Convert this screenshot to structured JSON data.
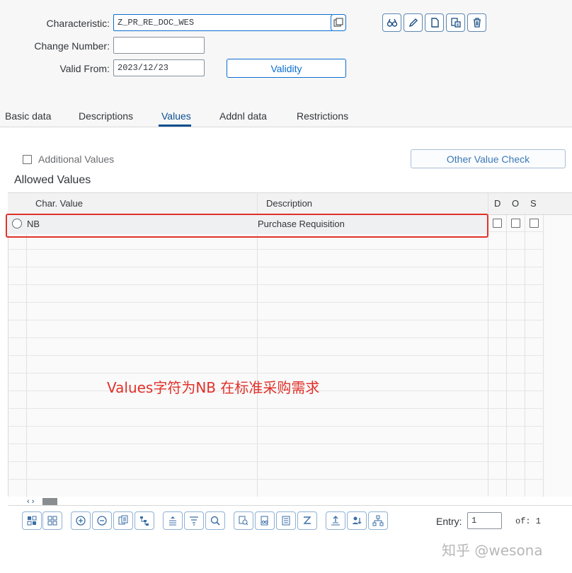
{
  "header": {
    "characteristic_label": "Characteristic:",
    "characteristic_value": "Z_PR_RE_DOC_WES",
    "change_number_label": "Change Number:",
    "change_number_value": "",
    "valid_from_label": "Valid From:",
    "valid_from_value": "2023/12/23",
    "validity_button": "Validity",
    "toolbar_icons": [
      "display-glasses-icon",
      "pencil-icon",
      "document-icon",
      "copy-document-icon",
      "trash-icon"
    ]
  },
  "tabs": [
    {
      "label": "Basic data"
    },
    {
      "label": "Descriptions"
    },
    {
      "label": "Values",
      "active": true
    },
    {
      "label": "Addnl data"
    },
    {
      "label": "Restrictions"
    }
  ],
  "values_tab": {
    "additional_values_label": "Additional Values",
    "other_value_check_button": "Other Value Check",
    "allowed_values_title": "Allowed Values",
    "columns": {
      "char_value": "Char. Value",
      "description": "Description",
      "d": "D",
      "o": "O",
      "s": "S"
    },
    "rows": [
      {
        "char_value": "NB",
        "description": "Purchase Requisition"
      }
    ],
    "scroll_arrows": "‹ ›"
  },
  "annotation": {
    "text": "Values字符为NB 在标准采购需求",
    "color": "#e0312a"
  },
  "footer": {
    "entry_label": "Entry:",
    "entry_value": "1",
    "of_label": "of: 1"
  },
  "watermark": "知乎 @wesona",
  "colors": {
    "accent": "#0a6ed1",
    "highlight_border": "#e0312a"
  }
}
